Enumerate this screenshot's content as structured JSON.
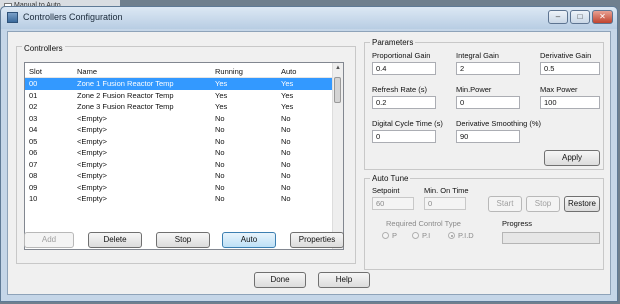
{
  "background_window": {
    "item": "Manual to Auto"
  },
  "window": {
    "title": "Controllers Configuration",
    "buttons": [
      "–",
      "□",
      "✕"
    ]
  },
  "controllers": {
    "label": "Controllers",
    "columns": [
      "Slot",
      "Name",
      "Running",
      "Auto"
    ],
    "rows": [
      [
        "00",
        "Zone 1 Fusion Reactor Temp",
        "Yes",
        "Yes"
      ],
      [
        "01",
        "Zone 2 Fusion Reactor Temp",
        "Yes",
        "Yes"
      ],
      [
        "02",
        "Zone 3 Fusion Reactor Temp",
        "Yes",
        "Yes"
      ],
      [
        "03",
        "<Empty>",
        "No",
        "No"
      ],
      [
        "04",
        "<Empty>",
        "No",
        "No"
      ],
      [
        "05",
        "<Empty>",
        "No",
        "No"
      ],
      [
        "06",
        "<Empty>",
        "No",
        "No"
      ],
      [
        "07",
        "<Empty>",
        "No",
        "No"
      ],
      [
        "08",
        "<Empty>",
        "No",
        "No"
      ],
      [
        "09",
        "<Empty>",
        "No",
        "No"
      ],
      [
        "10",
        "<Empty>",
        "No",
        "No"
      ]
    ],
    "selected_index": 0,
    "buttons": {
      "add": "Add",
      "delete": "Delete",
      "stop": "Stop",
      "auto": "Auto",
      "properties": "Properties"
    }
  },
  "parameters": {
    "label": "Parameters",
    "proportional_gain": {
      "label": "Proportional Gain",
      "value": "0.4"
    },
    "integral_gain": {
      "label": "Integral Gain",
      "value": "2"
    },
    "derivative_gain": {
      "label": "Derivative Gain",
      "value": "0.5"
    },
    "refresh_rate": {
      "label": "Refresh Rate (s)",
      "value": "0.2"
    },
    "min_power": {
      "label": "Min.Power",
      "value": "0"
    },
    "max_power": {
      "label": "Max Power",
      "value": "100"
    },
    "digital_cycle_time": {
      "label": "Digital Cycle Time (s)",
      "value": "0"
    },
    "derivative_smoothing": {
      "label": "Derivative Smoothing (%)",
      "value": "90"
    },
    "apply": "Apply"
  },
  "auto_tune": {
    "label": "Auto Tune",
    "setpoint": {
      "label": "Setpoint",
      "value": "60"
    },
    "min_on_time": {
      "label": "Min. On Time",
      "value": "0"
    },
    "start": "Start",
    "stop": "Stop",
    "restore": "Restore",
    "required_control_type": "Required Control Type",
    "control_types": [
      "P",
      "P.I",
      "P.I.D"
    ],
    "selected_control_type": "P.I.D",
    "progress_label": "Progress",
    "progress": 0
  },
  "footer": {
    "done": "Done",
    "help": "Help"
  }
}
